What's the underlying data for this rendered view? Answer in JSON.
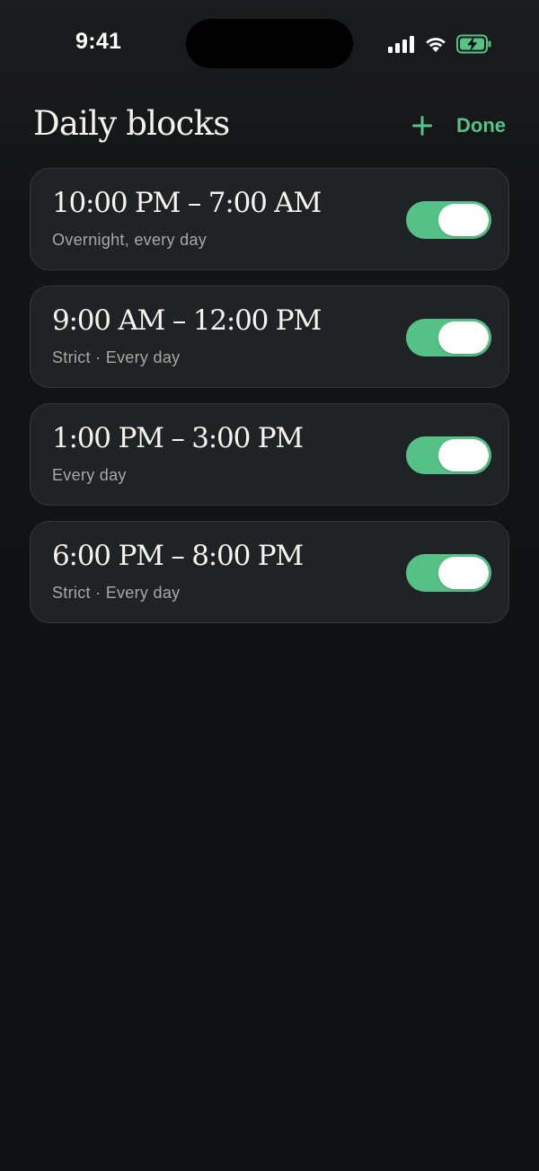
{
  "status_bar": {
    "time": "9:41",
    "icons": [
      "cellular-signal-icon",
      "wifi-icon",
      "battery-charging-icon"
    ]
  },
  "header": {
    "title": "Daily blocks",
    "add_icon": "plus-icon",
    "done_label": "Done"
  },
  "blocks": [
    {
      "time_range": "10:00 PM – 7:00 AM",
      "subtitle": "Overnight, every day",
      "enabled": true
    },
    {
      "time_range": "9:00 AM – 12:00 PM",
      "subtitle": "Strict · Every day",
      "enabled": true
    },
    {
      "time_range": "1:00 PM – 3:00 PM",
      "subtitle": "Every day",
      "enabled": true
    },
    {
      "time_range": "6:00 PM – 8:00 PM",
      "subtitle": "Strict · Every day",
      "enabled": true
    }
  ],
  "colors": {
    "accent": "#55c186",
    "background": "#0c1010",
    "card": "#1f2325",
    "secondary_text": "#a3aaa4"
  }
}
